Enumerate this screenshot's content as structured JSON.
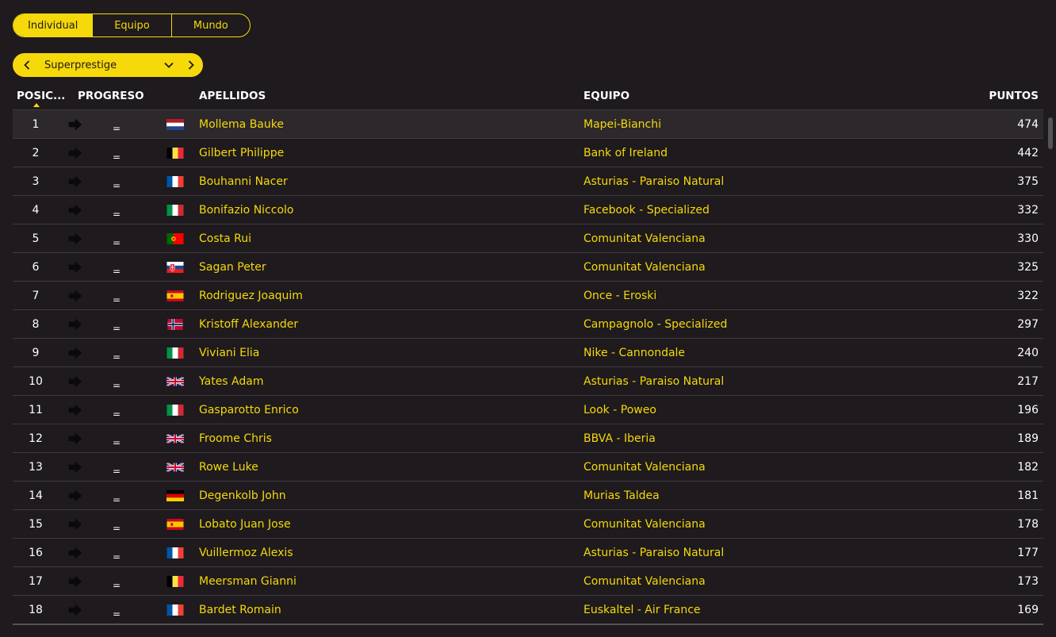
{
  "tabs": [
    {
      "label": "Individual",
      "active": true
    },
    {
      "label": "Equipo",
      "active": false
    },
    {
      "label": "Mundo",
      "active": false
    }
  ],
  "selector": {
    "prev_icon": "chevron-left-icon",
    "label": "Superprestige",
    "caret_icon": "chevron-down-icon",
    "next_icon": "chevron-right-icon"
  },
  "columns": {
    "position": "POSIC...",
    "progress": "PROGRESO",
    "name": "APELLIDOS",
    "team": "EQUIPO",
    "points": "PUNTOS"
  },
  "colors": {
    "accent": "#f5d90a",
    "background": "#1e1a1d",
    "row_highlight": "#2c282b",
    "divider": "#3e3a3d"
  },
  "rows": [
    {
      "pos": "1",
      "trend": "=",
      "flag": "NL",
      "name": "Mollema Bauke",
      "team": "Mapei-Bianchi",
      "points": "474"
    },
    {
      "pos": "2",
      "trend": "=",
      "flag": "BE",
      "name": "Gilbert Philippe",
      "team": "Bank of Ireland",
      "points": "442"
    },
    {
      "pos": "3",
      "trend": "=",
      "flag": "FR",
      "name": "Bouhanni Nacer",
      "team": "Asturias - Paraiso Natural",
      "points": "375"
    },
    {
      "pos": "4",
      "trend": "=",
      "flag": "IT",
      "name": "Bonifazio Niccolo",
      "team": "Facebook - Specialized",
      "points": "332"
    },
    {
      "pos": "5",
      "trend": "=",
      "flag": "PT",
      "name": "Costa Rui",
      "team": "Comunitat Valenciana",
      "points": "330"
    },
    {
      "pos": "6",
      "trend": "=",
      "flag": "SK",
      "name": "Sagan Peter",
      "team": "Comunitat Valenciana",
      "points": "325"
    },
    {
      "pos": "7",
      "trend": "=",
      "flag": "ES",
      "name": "Rodriguez Joaquim",
      "team": "Once - Eroski",
      "points": "322"
    },
    {
      "pos": "8",
      "trend": "=",
      "flag": "NO",
      "name": "Kristoff Alexander",
      "team": "Campagnolo - Specialized",
      "points": "297"
    },
    {
      "pos": "9",
      "trend": "=",
      "flag": "IT",
      "name": "Viviani Elia",
      "team": "Nike - Cannondale",
      "points": "240"
    },
    {
      "pos": "10",
      "trend": "=",
      "flag": "GB",
      "name": "Yates Adam",
      "team": "Asturias - Paraiso Natural",
      "points": "217"
    },
    {
      "pos": "11",
      "trend": "=",
      "flag": "IT",
      "name": "Gasparotto Enrico",
      "team": "Look - Poweo",
      "points": "196"
    },
    {
      "pos": "12",
      "trend": "=",
      "flag": "GB",
      "name": "Froome Chris",
      "team": "BBVA - Iberia",
      "points": "189"
    },
    {
      "pos": "13",
      "trend": "=",
      "flag": "GB",
      "name": "Rowe Luke",
      "team": "Comunitat Valenciana",
      "points": "182"
    },
    {
      "pos": "14",
      "trend": "=",
      "flag": "DE",
      "name": "Degenkolb John",
      "team": "Murias Taldea",
      "points": "181"
    },
    {
      "pos": "15",
      "trend": "=",
      "flag": "ES",
      "name": "Lobato Juan Jose",
      "team": "Comunitat Valenciana",
      "points": "178"
    },
    {
      "pos": "16",
      "trend": "=",
      "flag": "FR",
      "name": "Vuillermoz Alexis",
      "team": "Asturias - Paraiso Natural",
      "points": "177"
    },
    {
      "pos": "17",
      "trend": "=",
      "flag": "BE",
      "name": "Meersman Gianni",
      "team": "Comunitat Valenciana",
      "points": "173"
    },
    {
      "pos": "18",
      "trend": "=",
      "flag": "FR",
      "name": "Bardet Romain",
      "team": "Euskaltel - Air France",
      "points": "169"
    }
  ]
}
